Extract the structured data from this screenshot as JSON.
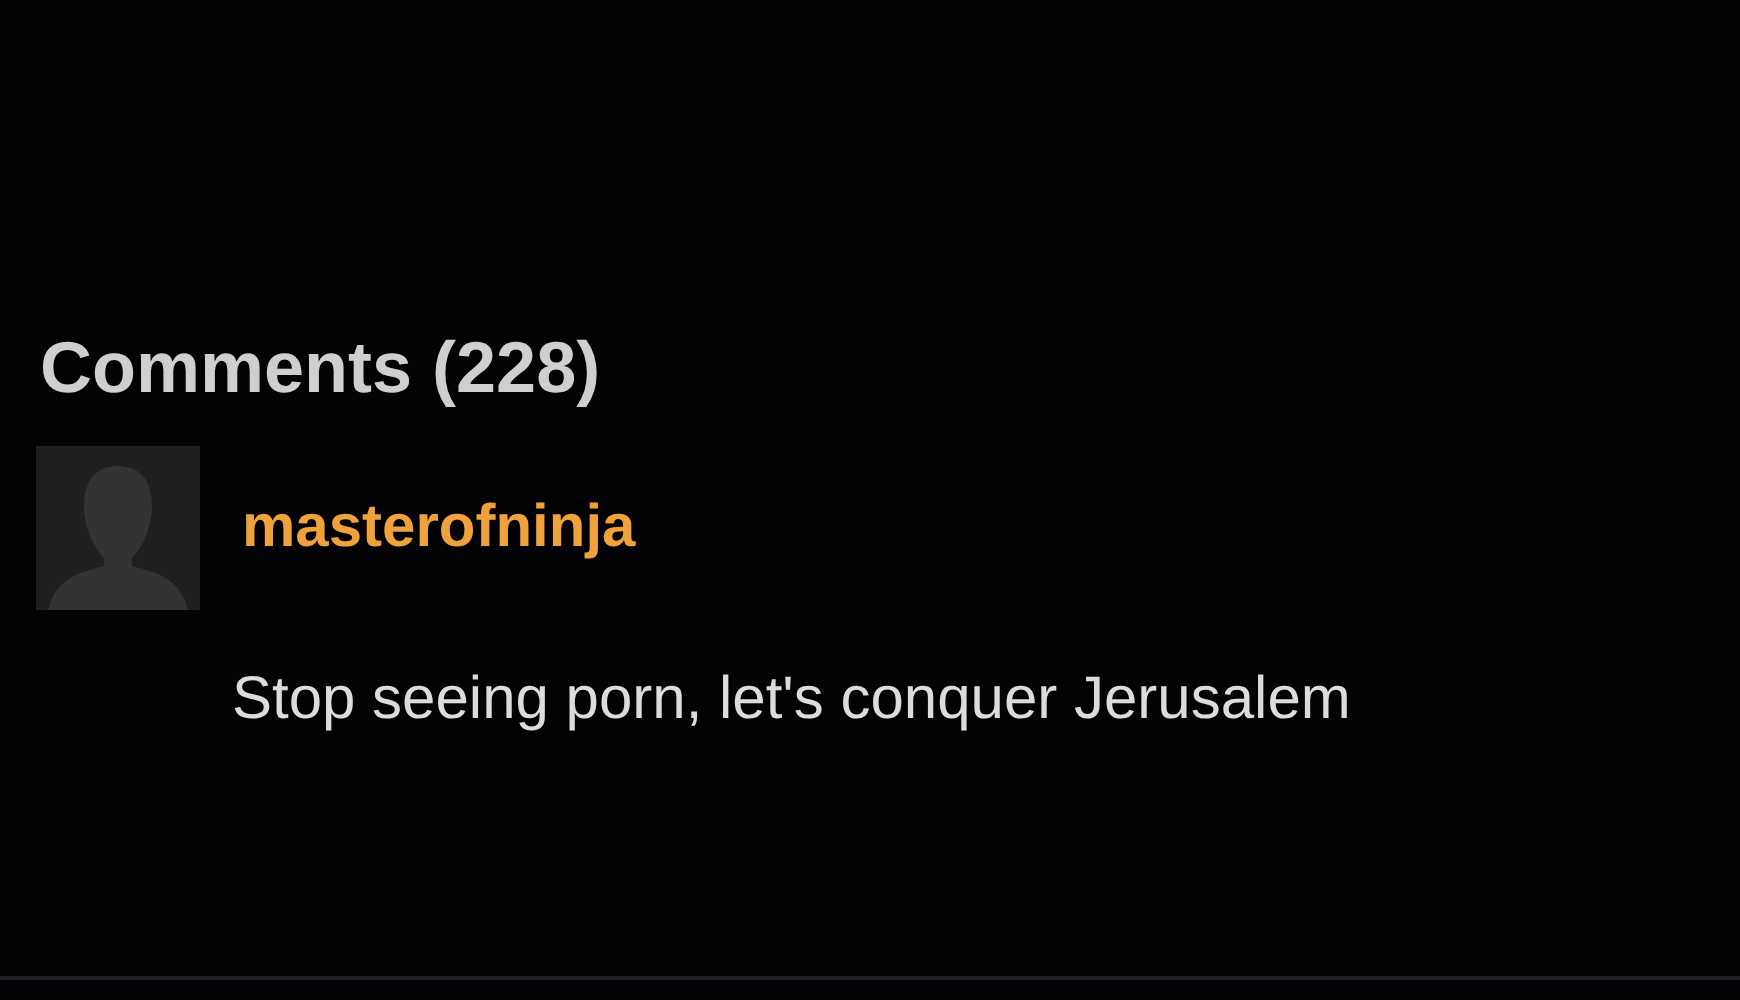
{
  "comments_heading": "Comments (228)",
  "comments": [
    {
      "username": "masterofninja",
      "text": "Stop seeing porn, let's conquer Jerusalem"
    }
  ]
}
